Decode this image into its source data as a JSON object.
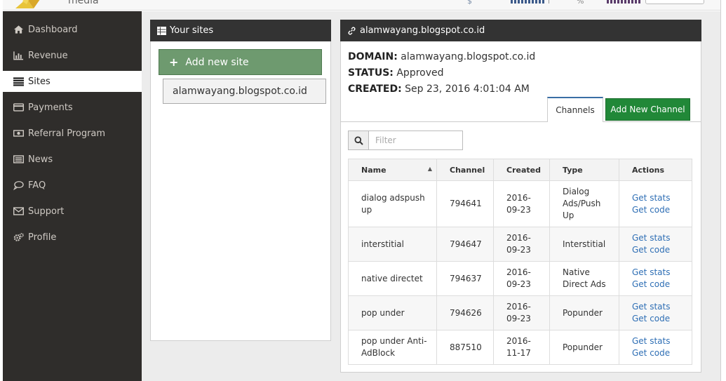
{
  "header": {
    "brand": "media",
    "currency_symbol": "$",
    "percent_symbol": "%"
  },
  "sidebar": {
    "items": [
      {
        "label": "Dashboard",
        "icon": "home-icon",
        "active": false
      },
      {
        "label": "Revenue",
        "icon": "bar-chart-icon",
        "active": false
      },
      {
        "label": "Sites",
        "icon": "list-icon",
        "active": true
      },
      {
        "label": "Payments",
        "icon": "credit-card-icon",
        "active": false
      },
      {
        "label": "Referral Program",
        "icon": "money-icon",
        "active": false
      },
      {
        "label": "News",
        "icon": "newspaper-icon",
        "active": false
      },
      {
        "label": "FAQ",
        "icon": "comment-icon",
        "active": false
      },
      {
        "label": "Support",
        "icon": "envelope-icon",
        "active": false
      },
      {
        "label": "Profile",
        "icon": "cogs-icon",
        "active": false
      }
    ]
  },
  "sites_panel": {
    "title": "Your sites",
    "add_button": "Add new site",
    "sites": [
      "alamwayang.blogspot.co.id"
    ]
  },
  "detail_panel": {
    "title": "alamwayang.blogspot.co.id",
    "domain_label": "DOMAIN:",
    "domain_value": "alamwayang.blogspot.co.id",
    "status_label": "STATUS:",
    "status_value": "Approved",
    "created_label": "CREATED:",
    "created_value": "Sep 23, 2016 4:01:04 AM",
    "tab_channels": "Channels",
    "add_channel_button": "Add New Channel",
    "filter_placeholder": "Filter",
    "table": {
      "columns": [
        "Name",
        "Channel",
        "Created",
        "Type",
        "Actions"
      ],
      "rows": [
        {
          "name": [
            "dialog adspush",
            "up"
          ],
          "channel": "794641",
          "created": [
            "2016-",
            "09-23"
          ],
          "type": [
            "Dialog",
            "Ads/Push",
            "Up"
          ]
        },
        {
          "name": [
            "interstitial"
          ],
          "channel": "794647",
          "created": [
            "2016-",
            "09-23"
          ],
          "type": [
            "Interstitial"
          ]
        },
        {
          "name": [
            "native directet"
          ],
          "channel": "794637",
          "created": [
            "2016-",
            "09-23"
          ],
          "type": [
            "Native",
            "Direct Ads"
          ]
        },
        {
          "name": [
            "pop under"
          ],
          "channel": "794626",
          "created": [
            "2016-",
            "09-23"
          ],
          "type": [
            "Popunder"
          ]
        },
        {
          "name": [
            "pop under Anti-",
            "AdBlock"
          ],
          "channel": "887510",
          "created": [
            "2016-",
            "11-17"
          ],
          "type": [
            "Popunder"
          ]
        }
      ],
      "action_stats": "Get stats",
      "action_code": "Get code"
    }
  },
  "colors": {
    "sidebar_bg": "#2f2d2b",
    "panel_header": "#333333",
    "add_site_green": "#6e9a6f",
    "add_channel_green": "#218838",
    "link_blue": "#2f6fb5"
  }
}
